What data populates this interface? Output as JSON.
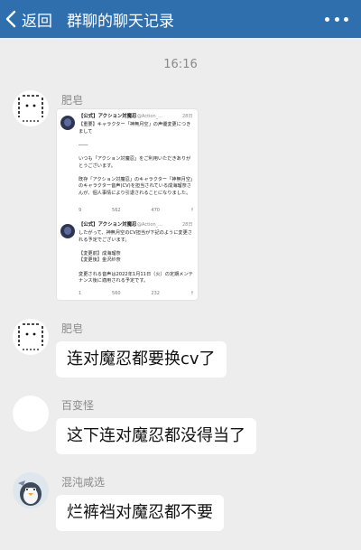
{
  "header": {
    "back_label": "返回",
    "title": "群聊的聊天记录",
    "bg_color": "#2f6fae"
  },
  "timestamp": "16:16",
  "messages": [
    {
      "sender": "肥皂",
      "avatar_icon": "bread-face-avatar",
      "type": "image",
      "image": {
        "tweets": [
          {
            "name": "【公式】アクション対魔忍",
            "handle": "@Action_...",
            "age": "28日",
            "body": "【重要】キャラクター「神無月空」の声優変更につきまして\n\n――\n\nいつも「アクション対魔忍」をご利用いただきありがとうございます。\n\n既存「アクション対魔忍」のキャラクター「神無月空」のキャラクター音声(CV)を担当されている成海瑠奈さんが、個人事情により引退されることになりました。",
            "stats": [
              "9",
              "562",
              "470",
              "↑"
            ]
          },
          {
            "name": "【公式】アクション対魔忍",
            "handle": "@Action_...",
            "age": "28日",
            "body": "したがって、神無月空のCV担当が下記のように変更される予定でございます。\n\n【変更前】成海瑠奈\n【変更後】金沢紗奈\n\n変更される音声は2022年1月11日（火）の定期メンテナンス後に適用される予定です。",
            "stats": [
              "1",
              "560",
              "232",
              "↑"
            ]
          }
        ]
      }
    },
    {
      "sender": "肥皂",
      "avatar_icon": "bread-face-avatar",
      "type": "text",
      "text": "连对魔忍都要换cv了"
    },
    {
      "sender": "百变怪",
      "avatar_icon": "white-circle-avatar",
      "type": "text",
      "text": "这下连对魔忍都没得当了"
    },
    {
      "sender": "混沌咸选",
      "avatar_icon": "penguin-avatar",
      "type": "text",
      "text": "烂裤裆对魔忍都不要"
    }
  ]
}
